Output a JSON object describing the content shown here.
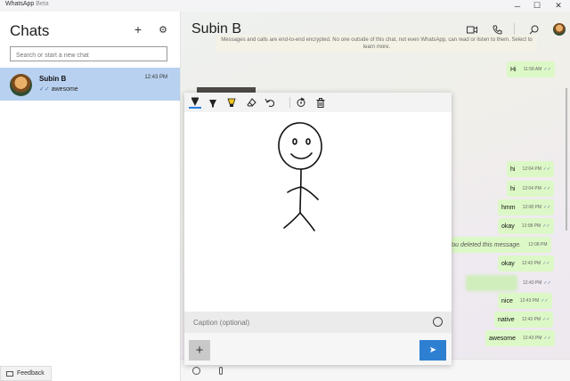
{
  "window": {
    "app_name": "WhatsApp",
    "app_badge": "Beta",
    "minimize": "─",
    "maximize": "☐",
    "close": "✕"
  },
  "sidebar": {
    "title": "Chats",
    "new_chat_glyph": "+",
    "settings_glyph": "⚙",
    "search_placeholder": "Search or start a new chat",
    "chats": [
      {
        "name": "Subin B",
        "time": "12:43 PM",
        "ticks": "✓✓",
        "preview": "awesome"
      }
    ],
    "feedback_label": "Feedback"
  },
  "conversation": {
    "contact_name": "Subin B",
    "encryption_notice": "Messages and calls are end-to-end encrypted. No one outside of this chat, not even WhatsApp, can read or listen to them. Select to learn more.",
    "messages": [
      {
        "text": "Hi",
        "time": "11:58 AM",
        "ticks": "✓✓"
      },
      {
        "text": "hi",
        "time": "12:04 PM",
        "ticks": "✓✓"
      },
      {
        "text": "hi",
        "time": "12:04 PM",
        "ticks": "✓✓"
      },
      {
        "text": "hmm",
        "time": "12:08 PM",
        "ticks": "✓✓"
      },
      {
        "text": "okay",
        "time": "12:08 PM",
        "ticks": "✓✓"
      },
      {
        "text": "You deleted this message.",
        "time": "12:08 PM",
        "ticks": ""
      },
      {
        "text": "okay",
        "time": "12:43 PM",
        "ticks": "✓✓"
      },
      {
        "text": "",
        "time": "12:43 PM",
        "ticks": "✓✓"
      },
      {
        "text": "nice",
        "time": "12:43 PM",
        "ticks": "✓✓"
      },
      {
        "text": "native",
        "time": "12:43 PM",
        "ticks": "✓✓"
      },
      {
        "text": "awesome",
        "time": "12:43 PM",
        "ticks": "✓✓"
      }
    ]
  },
  "drawing_editor": {
    "caption_placeholder": "Caption (optional)",
    "add_glyph": "+",
    "send_glyph": "➤",
    "tools": [
      "pen-black",
      "marker-black",
      "highlighter-yellow",
      "eraser",
      "undo",
      "rotate",
      "delete"
    ]
  },
  "colors": {
    "accent": "#2d7fd2",
    "selected_chat": "#b9d1f0",
    "bubble": "#dcf8c6"
  }
}
